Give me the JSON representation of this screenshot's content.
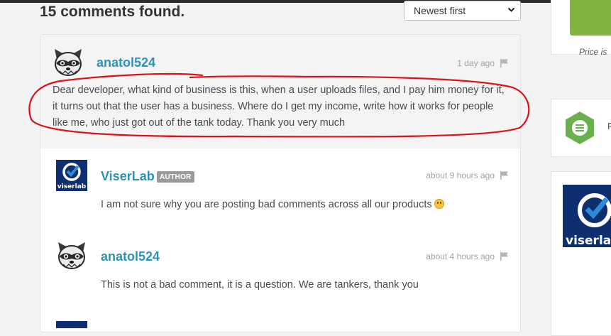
{
  "page": {
    "heading": "15 comments found.",
    "sort": {
      "selected": "Newest first"
    }
  },
  "comments": [
    {
      "username": "anatol524",
      "time": "1 day ago",
      "body": "Dear developer, what kind of business is this, when a user uploads files, and I pay him money for it, it turns out that the user has a business. Where do I get my income, write how it works for people like me, who just got out of the tank today. Thank you very much"
    },
    {
      "username": "ViserLab",
      "badge": "AUTHOR",
      "time": "about 9 hours ago",
      "body": "I am not sure why you are posting bad comments across all our products"
    },
    {
      "username": "anatol524",
      "time": "about 4 hours ago",
      "body": "This is not a bad comment, it is a question. We are tankers, thank you"
    }
  ],
  "sidebar": {
    "price_text": "Price is",
    "side2_text": "F"
  },
  "logos": {
    "viser_text": "viserlab"
  },
  "colors": {
    "link": "#2a93b8",
    "accent_green": "#82b440",
    "annotation": "#e0101a",
    "hex_badge": "#6ab04c"
  },
  "icons": [
    "raccoon-avatar-icon",
    "viserlab-logo-icon",
    "flag-icon",
    "smile-emoji-icon",
    "hexagon-badge-icon"
  ]
}
